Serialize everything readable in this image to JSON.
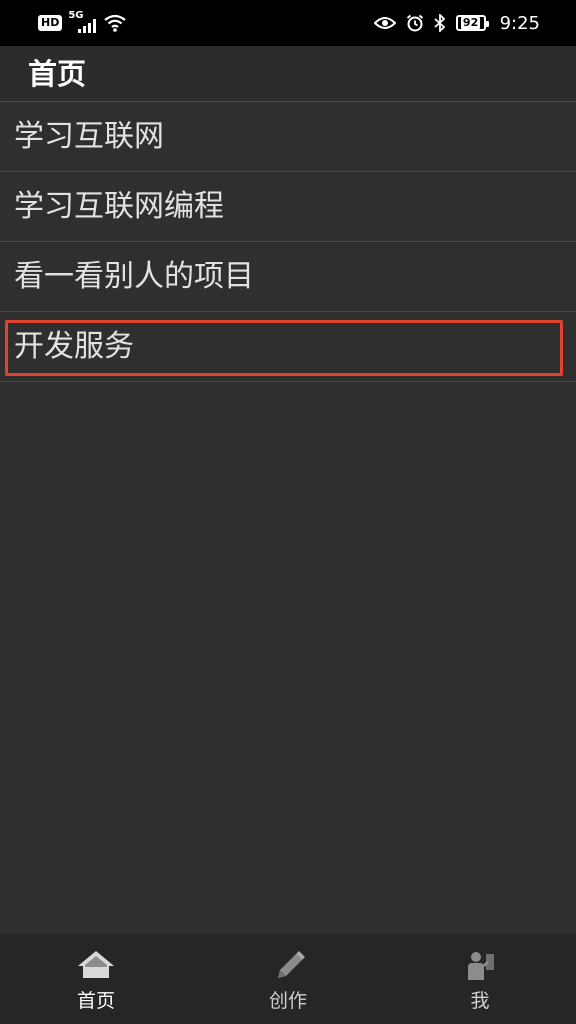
{
  "status_bar": {
    "hd_badge": "HD",
    "network_type": "5G",
    "battery_level": "92",
    "time": "9:25"
  },
  "header": {
    "title": "首页"
  },
  "menu": {
    "items": [
      {
        "label": "学习互联网"
      },
      {
        "label": "学习互联网编程"
      },
      {
        "label": "看一看别人的项目"
      },
      {
        "label": "开发服务",
        "highlighted": true
      }
    ]
  },
  "bottom_nav": {
    "tabs": [
      {
        "label": "首页",
        "icon": "home-icon",
        "active": true
      },
      {
        "label": "创作",
        "icon": "pencil-icon",
        "active": false
      },
      {
        "label": "我",
        "icon": "user-icon",
        "active": false
      }
    ]
  },
  "colors": {
    "background": "#2f2f2f",
    "highlight_border": "#e0432f",
    "status_bar": "#000000"
  }
}
